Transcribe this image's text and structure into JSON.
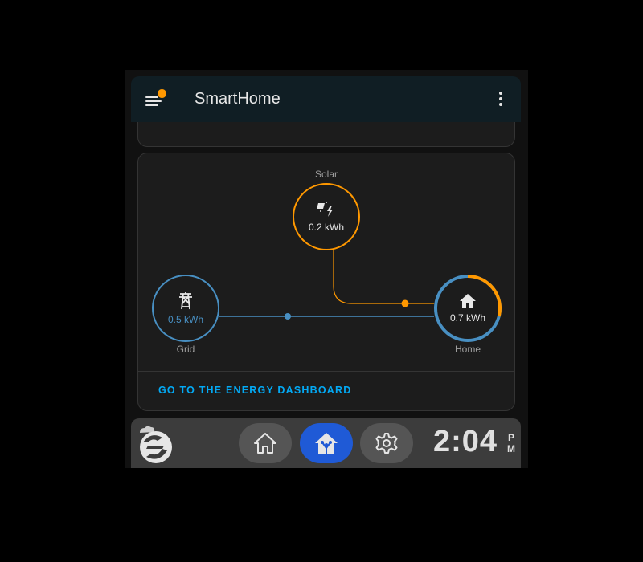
{
  "app": {
    "title": "SmartHome"
  },
  "energy": {
    "solar": {
      "label": "Solar",
      "value": "0.2 kWh"
    },
    "grid": {
      "label": "Grid",
      "value": "0.5 kWh"
    },
    "home": {
      "label": "Home",
      "value": "0.7 kWh",
      "solar_fraction": 0.29
    },
    "dashboard_link": "GO TO THE ENERGY DASHBOARD"
  },
  "dock": {
    "clock": "2:04",
    "ampm_top": "P",
    "ampm_bottom": "M",
    "buttons": [
      {
        "icon": "home-outline-icon"
      },
      {
        "icon": "home-assistant-icon",
        "active": true
      },
      {
        "icon": "gear-icon"
      }
    ]
  },
  "colors": {
    "solar": "#ff9800",
    "grid": "#488fc2",
    "link": "#03a9f4",
    "active_button": "#1f5ad6",
    "notification_dot": "#ff9800"
  }
}
